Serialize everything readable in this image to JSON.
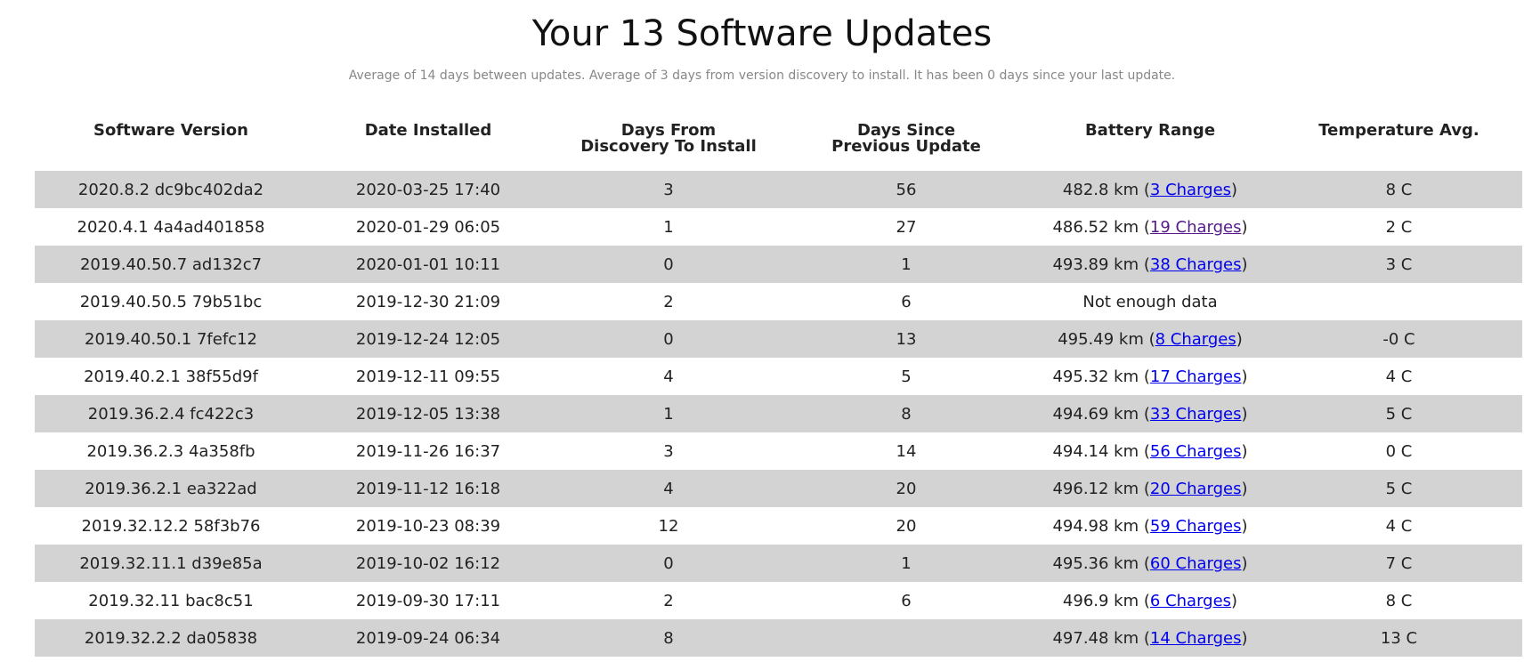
{
  "header": {
    "title": "Your 13 Software Updates",
    "subtitle": "Average of 14 days between updates. Average of 3 days from version discovery to install. It has been 0 days since your last update."
  },
  "table": {
    "columns": [
      {
        "line1": "Software Version",
        "line2": ""
      },
      {
        "line1": "Date Installed",
        "line2": ""
      },
      {
        "line1": "Days From",
        "line2": "Discovery To Install"
      },
      {
        "line1": "Days Since",
        "line2": "Previous Update"
      },
      {
        "line1": "Battery Range",
        "line2": ""
      },
      {
        "line1": "Temperature Avg.",
        "line2": ""
      }
    ],
    "link_colors": {
      "unvisited": "#0000ee",
      "visited": "#551a8b"
    },
    "stripe_color": "#d3d3d3",
    "rows": [
      {
        "version": "2020.8.2 dc9bc402da2",
        "date": "2020-03-25 17:40",
        "discovery": "3",
        "since": "56",
        "range": "482.8 km",
        "charges": "3 Charges",
        "temp": "8 C",
        "visited": false
      },
      {
        "version": "2020.4.1 4a4ad401858",
        "date": "2020-01-29 06:05",
        "discovery": "1",
        "since": "27",
        "range": "486.52 km",
        "charges": "19 Charges",
        "temp": "2 C",
        "visited": true
      },
      {
        "version": "2019.40.50.7 ad132c7",
        "date": "2020-01-01 10:11",
        "discovery": "0",
        "since": "1",
        "range": "493.89 km",
        "charges": "38 Charges",
        "temp": "3 C",
        "visited": false
      },
      {
        "version": "2019.40.50.5 79b51bc",
        "date": "2019-12-30 21:09",
        "discovery": "2",
        "since": "6",
        "range": "Not enough data",
        "charges": "",
        "temp": "",
        "visited": false
      },
      {
        "version": "2019.40.50.1 7fefc12",
        "date": "2019-12-24 12:05",
        "discovery": "0",
        "since": "13",
        "range": "495.49 km",
        "charges": "8 Charges",
        "temp": "-0 C",
        "visited": false
      },
      {
        "version": "2019.40.2.1 38f55d9f",
        "date": "2019-12-11 09:55",
        "discovery": "4",
        "since": "5",
        "range": "495.32 km",
        "charges": "17 Charges",
        "temp": "4 C",
        "visited": false
      },
      {
        "version": "2019.36.2.4 fc422c3",
        "date": "2019-12-05 13:38",
        "discovery": "1",
        "since": "8",
        "range": "494.69 km",
        "charges": "33 Charges",
        "temp": "5 C",
        "visited": false
      },
      {
        "version": "2019.36.2.3 4a358fb",
        "date": "2019-11-26 16:37",
        "discovery": "3",
        "since": "14",
        "range": "494.14 km",
        "charges": "56 Charges",
        "temp": "0 C",
        "visited": false
      },
      {
        "version": "2019.36.2.1 ea322ad",
        "date": "2019-11-12 16:18",
        "discovery": "4",
        "since": "20",
        "range": "496.12 km",
        "charges": "20 Charges",
        "temp": "5 C",
        "visited": false
      },
      {
        "version": "2019.32.12.2 58f3b76",
        "date": "2019-10-23 08:39",
        "discovery": "12",
        "since": "20",
        "range": "494.98 km",
        "charges": "59 Charges",
        "temp": "4 C",
        "visited": false
      },
      {
        "version": "2019.32.11.1 d39e85a",
        "date": "2019-10-02 16:12",
        "discovery": "0",
        "since": "1",
        "range": "495.36 km",
        "charges": "60 Charges",
        "temp": "7 C",
        "visited": false
      },
      {
        "version": "2019.32.11 bac8c51",
        "date": "2019-09-30 17:11",
        "discovery": "2",
        "since": "6",
        "range": "496.9 km",
        "charges": "6 Charges",
        "temp": "8 C",
        "visited": false
      },
      {
        "version": "2019.32.2.2 da05838",
        "date": "2019-09-24 06:34",
        "discovery": "8",
        "since": "",
        "range": "497.48 km",
        "charges": "14 Charges",
        "temp": "13 C",
        "visited": false
      }
    ]
  }
}
